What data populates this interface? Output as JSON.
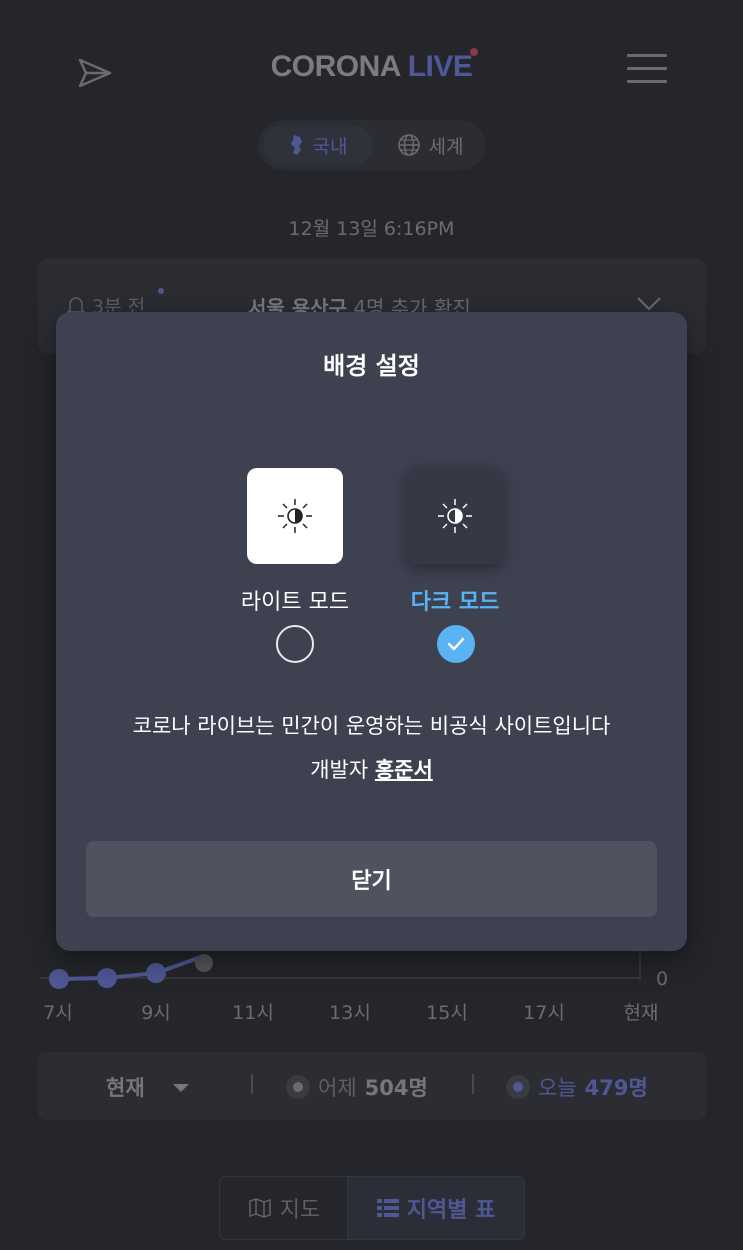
{
  "header": {
    "brand_part1": "CORONA",
    "brand_part2": "LIVE",
    "send_icon": "send-icon",
    "menu_icon": "hamburger-menu-icon"
  },
  "scope_tabs": [
    {
      "label": "국내",
      "icon": "korea-map-icon",
      "active": true
    },
    {
      "label": "세계",
      "icon": "globe-icon",
      "active": false
    }
  ],
  "updated_time": "12월 13일 6:16PM",
  "alert": {
    "time": "3분 전",
    "location": "서울 용산구",
    "message": "4명 추가 확진"
  },
  "chart": {
    "y_ticks": [
      "0",
      "0",
      "0",
      "0"
    ],
    "x_ticks": [
      "7시",
      "9시",
      "11시",
      "13시",
      "15시",
      "17시",
      "현재"
    ]
  },
  "legend": {
    "selector": "현재",
    "yesterday_label": "어제",
    "yesterday_value": "504명",
    "today_label": "오늘",
    "today_value": "479명"
  },
  "view_tabs": {
    "map": "지도",
    "table": "지역별 표"
  },
  "modal": {
    "title": "배경 설정",
    "light_label": "라이트 모드",
    "dark_label": "다크 모드",
    "selected": "dark",
    "description": "코로나 라이브는 민간이 운영하는 비공식 사이트입니다",
    "developer_prefix": "개발자",
    "developer_name": "홍준서",
    "close_label": "닫기"
  },
  "colors": {
    "accent": "#5ab3f5",
    "modal_bg": "#3d4150",
    "brand_live": "#4f5794"
  }
}
